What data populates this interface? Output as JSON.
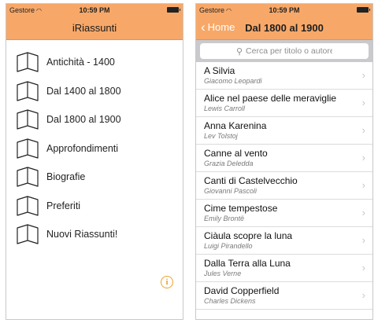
{
  "left": {
    "status": {
      "carrier": "Gestore",
      "time": "10:59 PM"
    },
    "title": "iRiassunti",
    "menu": [
      {
        "label": "Antichità - 1400"
      },
      {
        "label": "Dal 1400 al 1800"
      },
      {
        "label": "Dal 1800 al 1900"
      },
      {
        "label": "Approfondimenti"
      },
      {
        "label": "Biografie"
      },
      {
        "label": "Preferiti"
      },
      {
        "label": "Nuovi Riassunti!"
      }
    ],
    "info_glyph": "i"
  },
  "right": {
    "status": {
      "carrier": "Gestore",
      "time": "10:59 PM"
    },
    "back_label": "Home",
    "title": "Dal 1800 al 1900",
    "search_placeholder": "Cerca per titolo o autore",
    "rows": [
      {
        "title": "A Silvia",
        "author": "Giacomo Leopardi"
      },
      {
        "title": "Alice nel paese delle meraviglie",
        "author": "Lewis Carroll"
      },
      {
        "title": "Anna Karenina",
        "author": "Lev Tolstoj"
      },
      {
        "title": "Canne al vento",
        "author": "Grazia Deledda"
      },
      {
        "title": "Canti di Castelvecchio",
        "author": "Giovanni Pascoli"
      },
      {
        "title": "Cime tempestose",
        "author": "Emily Brontë"
      },
      {
        "title": "Ciàula scopre la luna",
        "author": "Luigi Pirandello"
      },
      {
        "title": "Dalla Terra alla Luna",
        "author": "Jules Verne"
      },
      {
        "title": "David Copperfield",
        "author": "Charles Dickens"
      }
    ]
  },
  "colors": {
    "nav": "#f7a868",
    "info": "#f0a030"
  },
  "icons": {
    "menu": "book-icon",
    "info": "info-icon",
    "back": "chevron-left-icon",
    "row": "chevron-right-icon",
    "search": "search-icon"
  }
}
